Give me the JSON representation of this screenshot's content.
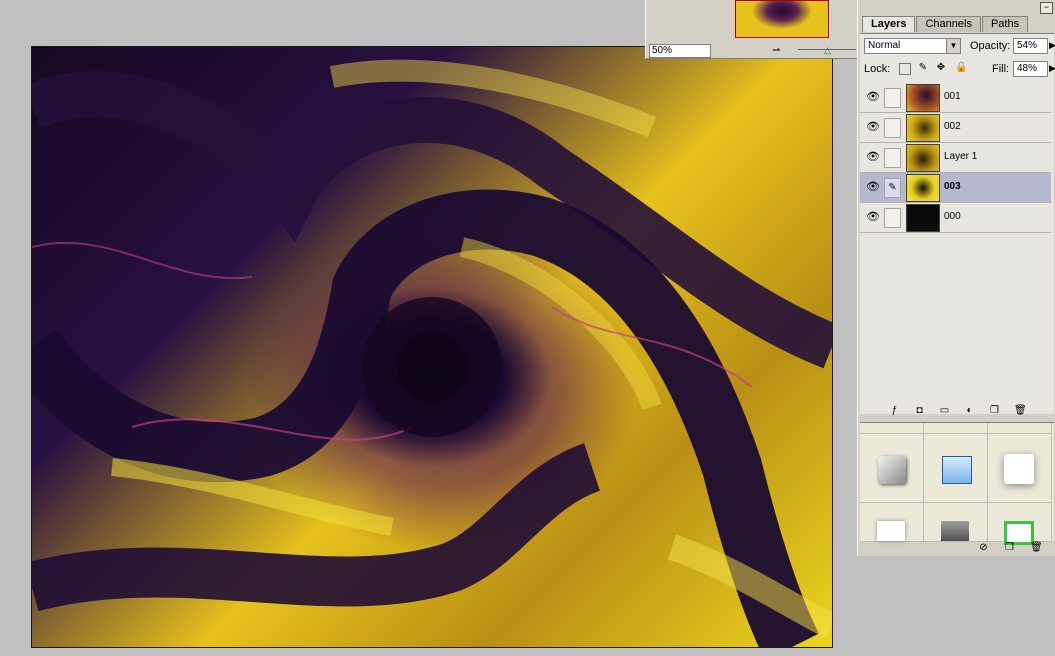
{
  "navigator": {
    "zoom": "50%",
    "zoom_out_icon": "zoom-out-icon",
    "zoom_slider_icon": "zoom-slider-thumb-icon"
  },
  "layers_palette": {
    "tabs": [
      {
        "label": "Layers",
        "active": true
      },
      {
        "label": "Channels",
        "active": false
      },
      {
        "label": "Paths",
        "active": false
      }
    ],
    "blend_mode": "Normal",
    "opacity_label": "Opacity:",
    "opacity_value": "54%",
    "lock_label": "Lock:",
    "fill_label": "Fill:",
    "fill_value": "48%",
    "layers": [
      {
        "name": "001",
        "visible": true,
        "selected": false
      },
      {
        "name": "002",
        "visible": true,
        "selected": false
      },
      {
        "name": "Layer 1",
        "visible": true,
        "selected": false
      },
      {
        "name": "003",
        "visible": true,
        "selected": true,
        "brush": true
      },
      {
        "name": "000",
        "visible": true,
        "selected": false
      }
    ],
    "bottom_icons": [
      "link-layers-icon",
      "layer-style-icon",
      "layer-mask-icon",
      "new-group-icon",
      "adjustment-layer-icon",
      "new-layer-icon",
      "trash-icon"
    ]
  },
  "styles_panel": {
    "bottom_icons": [
      "clear-style-icon",
      "new-style-icon",
      "trash-icon"
    ]
  },
  "colors": {
    "selected_row": "#b6b8d0",
    "panel_bg": "#d4d0c8",
    "fractal_yellow": "#e7c21d",
    "fractal_dark": "#1a0830"
  }
}
